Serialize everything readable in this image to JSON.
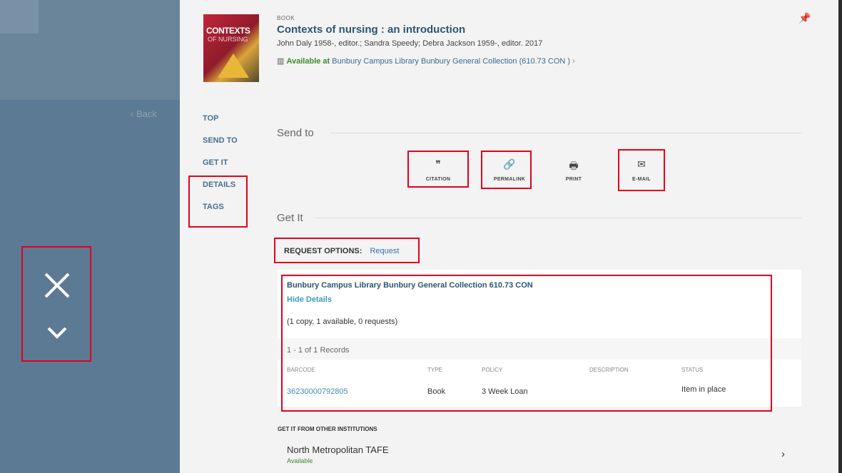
{
  "left": {
    "back_label": "‹ Back"
  },
  "record": {
    "type_label": "BOOK",
    "title": "Contexts of nursing : an introduction",
    "authors": "John Daly 1958-, editor.; Sandra Speedy; Debra Jackson 1959-, editor. 2017",
    "availability_status": "Available at",
    "availability_location": "Bunbury Campus Library  Bunbury General Collection (610.73 CON )",
    "cover_title": "CONTEXTS",
    "cover_subtitle": "OF NURSING"
  },
  "nav": {
    "items": [
      {
        "label": "TOP"
      },
      {
        "label": "SEND TO"
      },
      {
        "label": "GET IT"
      },
      {
        "label": "DETAILS"
      },
      {
        "label": "TAGS"
      }
    ]
  },
  "send_to": {
    "heading": "Send to",
    "actions": [
      {
        "label": "CITATION",
        "icon": "quote-icon"
      },
      {
        "label": "PERMALINK",
        "icon": "link-icon"
      },
      {
        "label": "PRINT",
        "icon": "printer-icon"
      },
      {
        "label": "E-MAIL",
        "icon": "envelope-icon"
      }
    ]
  },
  "get_it": {
    "heading": "Get It",
    "request_options_label": "REQUEST OPTIONS:",
    "request_link": "Request",
    "holding": {
      "location": "Bunbury Campus Library  Bunbury General Collection  610.73 CON",
      "hide_details": "Hide Details",
      "copies": "(1 copy, 1 available, 0 requests)",
      "records": "1 - 1 of 1 Records",
      "columns": [
        "BARCODE",
        "TYPE",
        "POLICY",
        "DESCRIPTION",
        "STATUS"
      ],
      "rows": [
        {
          "barcode": "36230000792805",
          "type": "Book",
          "policy": "3 Week Loan",
          "description": "",
          "status": "Item in place"
        }
      ]
    }
  },
  "other_institutions": {
    "heading": "GET IT FROM OTHER INSTITUTIONS",
    "name": "North Metropolitan TAFE",
    "status": "Available"
  },
  "colors": {
    "highlight_box": "#e3001b",
    "accent": "#2c5570",
    "available": "#3a8a2b",
    "overlay": "#5d7a94"
  }
}
